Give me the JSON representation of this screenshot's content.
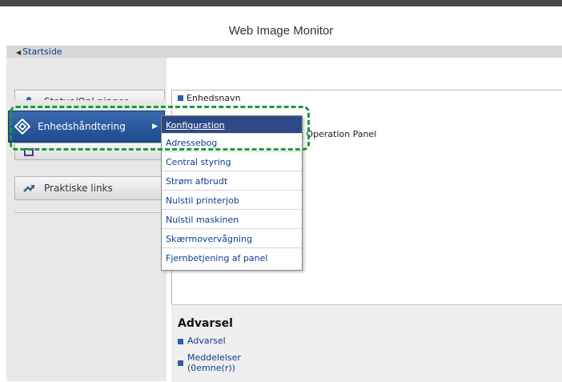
{
  "header": {
    "title": "Web Image Monitor"
  },
  "breadcrumb": {
    "label": "Startside"
  },
  "nav": {
    "status": "Status/Opl.ninger",
    "device": "Enhedshåndtering",
    "links": "Praktiske links"
  },
  "main": {
    "device_name_label": "Enhedsnavn",
    "device_value": "rt Operation Panel",
    "warning_title": "Advarsel",
    "warning_link": "Advarsel",
    "messages_line1": "Meddelelser",
    "messages_line2": "(0emne(r))"
  },
  "menu": {
    "items": [
      "Konfiguration",
      "Adressebog",
      "Central styring",
      "Strøm afbrudt",
      "Nulstil printerjob",
      "Nulstil maskinen",
      "Skærmovervågning",
      "Fjernbetjening af panel"
    ]
  },
  "colors": {
    "selected": "#2d4a87",
    "link": "#0a3f8c",
    "highlight": "#1a9c3a"
  }
}
